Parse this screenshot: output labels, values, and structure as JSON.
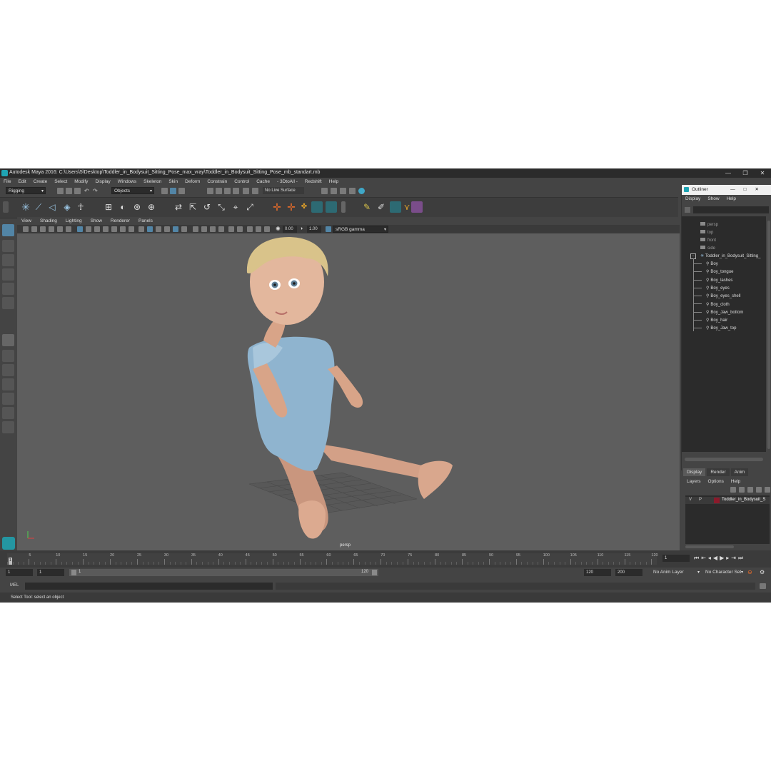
{
  "window": {
    "title": "Autodesk Maya 2016: C:\\Users\\5\\Desktop\\Toddler_in_Bodysuit_Sitting_Pose_max_vray\\Toddler_in_Bodysuit_Sitting_Pose_mb_standart.mb",
    "min": "—",
    "max": "❐",
    "close": "✕"
  },
  "menu": [
    "File",
    "Edit",
    "Create",
    "Select",
    "Modify",
    "Display",
    "Windows",
    "Skeleton",
    "Skin",
    "Deform",
    "Constrain",
    "Control",
    "Cache",
    "- 3DtoAll -",
    "Redshift",
    "Help"
  ],
  "status": {
    "mode": "Rigging",
    "objects": "Objects",
    "live_surface": "No Live Surface"
  },
  "panel_menu": [
    "View",
    "Shading",
    "Lighting",
    "Show",
    "Renderer",
    "Panels"
  ],
  "panel_tools": {
    "exposure": "0.00",
    "gamma": "1.00",
    "color_space": "sRGB gamma"
  },
  "viewport": {
    "camera": "persp"
  },
  "outliner": {
    "title": "Outliner",
    "menu": [
      "Display",
      "Show",
      "Help"
    ],
    "cameras": [
      "persp",
      "top",
      "front",
      "side"
    ],
    "group": "Toddler_in_Bodysuit_Sitting_",
    "children": [
      "Boy",
      "Boy_tongue",
      "Boy_lashes",
      "Boy_eyes",
      "Boy_eyes_shell",
      "Boy_cloth",
      "Boy_Jaw_bottom",
      "Boy_hair",
      "Boy_Jaw_top"
    ]
  },
  "layer_editor": {
    "tabs": [
      "Display",
      "Render",
      "Anim"
    ],
    "menu": [
      "Layers",
      "Options",
      "Help"
    ],
    "layer": {
      "v": "V",
      "p": "P",
      "name": "Toddler_in_Bodysuit_S",
      "color": "#8b1a2b"
    }
  },
  "timeline": {
    "ticks": [
      "5",
      "10",
      "15",
      "20",
      "25",
      "30",
      "35",
      "40",
      "45",
      "50",
      "55",
      "60",
      "65",
      "70",
      "75",
      "80",
      "85",
      "90",
      "95",
      "100",
      "105",
      "110",
      "115",
      "120"
    ],
    "current_frame": "1",
    "start_marker": "1"
  },
  "range": {
    "start": "1",
    "playback_start": "1",
    "slider_start": "1",
    "slider_end": "120",
    "playback_end": "120",
    "end": "200",
    "anim_layer": "No Anim Layer",
    "char_set": "No Character Set"
  },
  "command": {
    "lang": "MEL"
  },
  "help_line": "Select Tool: select an object",
  "colors": {
    "accent": "#5285a6",
    "maya_teal": "#1fa4b3",
    "viewport_bg": "#5e5e5e"
  }
}
